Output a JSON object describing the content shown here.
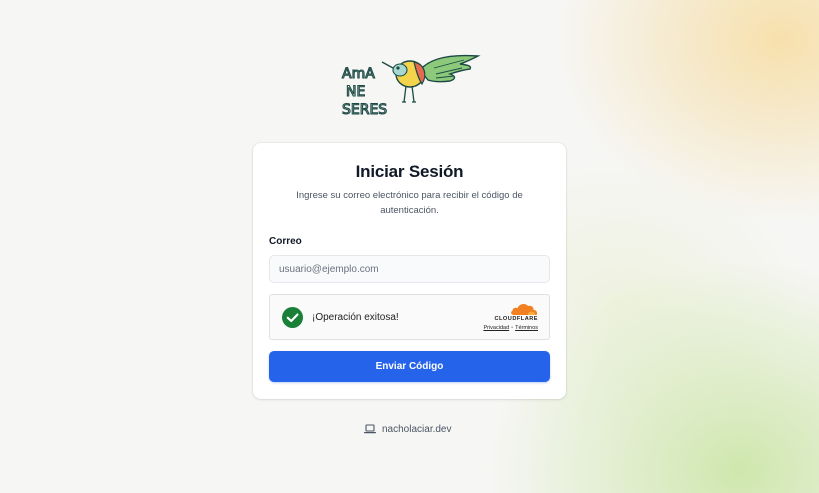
{
  "logo": {
    "alt": "Amaneseres",
    "line1": "AmA",
    "line2": "NE",
    "line3": "SERES"
  },
  "login": {
    "title": "Iniciar Sesión",
    "subtitle": "Ingrese su correo electrónico para recibir el código de autenticación.",
    "email_label": "Correo",
    "email_placeholder": "usuario@ejemplo.com",
    "email_value": "",
    "submit_label": "Enviar Código"
  },
  "captcha": {
    "status_text": "¡Operación exitosa!",
    "provider": "CLOUDFLARE",
    "privacy_label": "Privacidad",
    "separator": "•",
    "terms_label": "Términos",
    "success_color": "#1a7f37",
    "brand_color": "#f38020"
  },
  "footer": {
    "link_text": "nacholaciar.dev",
    "icon": "laptop-icon"
  },
  "theme": {
    "accent": "#2563eb",
    "card_bg": "#ffffff"
  }
}
